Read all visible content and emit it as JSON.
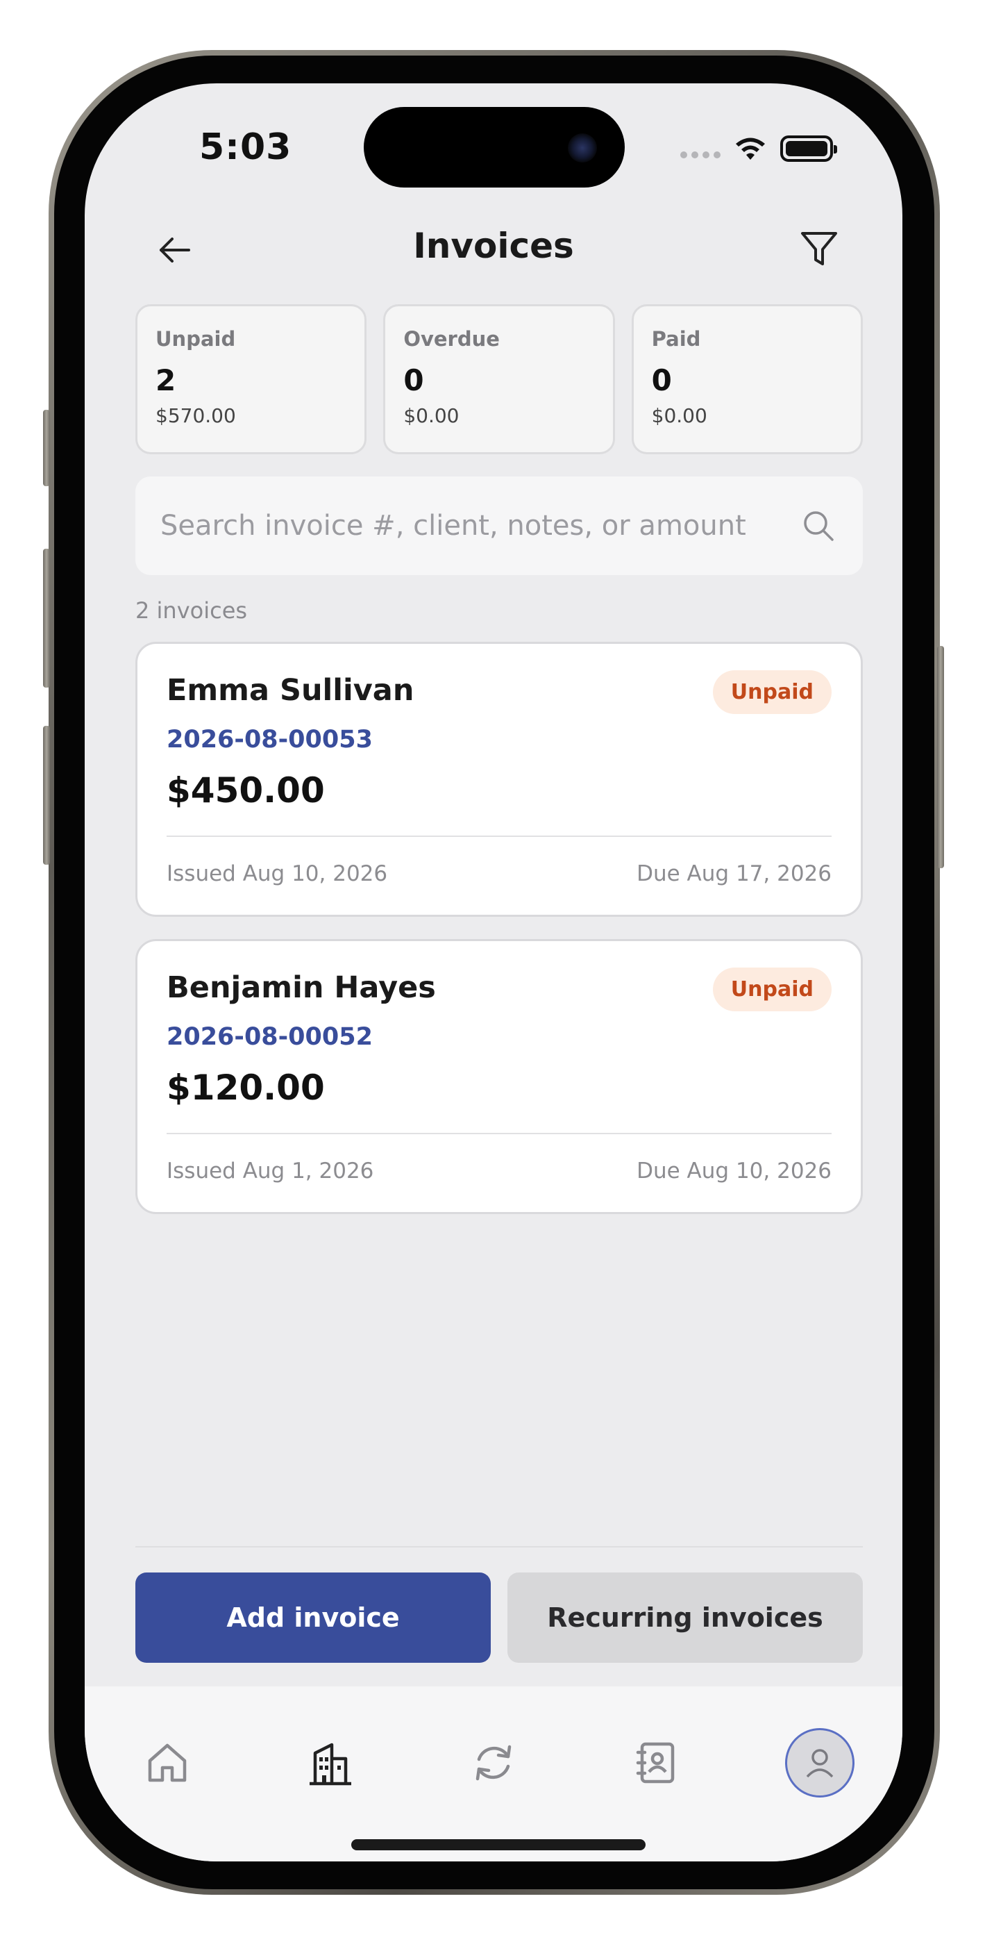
{
  "status_bar": {
    "time": "5:03"
  },
  "header": {
    "title": "Invoices",
    "back_icon": "arrow-left-icon",
    "filter_icon": "filter-icon"
  },
  "summary": [
    {
      "label": "Unpaid",
      "count": "2",
      "amount": "$570.00"
    },
    {
      "label": "Overdue",
      "count": "0",
      "amount": "$0.00"
    },
    {
      "label": "Paid",
      "count": "0",
      "amount": "$0.00"
    }
  ],
  "search": {
    "placeholder": "Search invoice #, client, notes, or amount",
    "value": ""
  },
  "list": {
    "count_label": "2 invoices"
  },
  "invoices": [
    {
      "client": "Emma Sullivan",
      "number": "2026-08-00053",
      "amount": "$450.00",
      "status": "Unpaid",
      "issued": "Issued Aug 10, 2026",
      "due": "Due Aug 17, 2026"
    },
    {
      "client": "Benjamin Hayes",
      "number": "2026-08-00052",
      "amount": "$120.00",
      "status": "Unpaid",
      "issued": "Issued Aug 1, 2026",
      "due": "Due Aug 10, 2026"
    }
  ],
  "actions": {
    "add_label": "Add invoice",
    "recurring_label": "Recurring invoices"
  },
  "tab_bar": {
    "items": [
      "home-icon",
      "building-icon",
      "refresh-icon",
      "contacts-icon",
      "profile-icon"
    ],
    "active": "building-icon"
  },
  "colors": {
    "accent": "#394d9b",
    "badge_bg": "#fdebdf",
    "badge_text": "#c2491a",
    "screen_bg": "#ececee"
  }
}
